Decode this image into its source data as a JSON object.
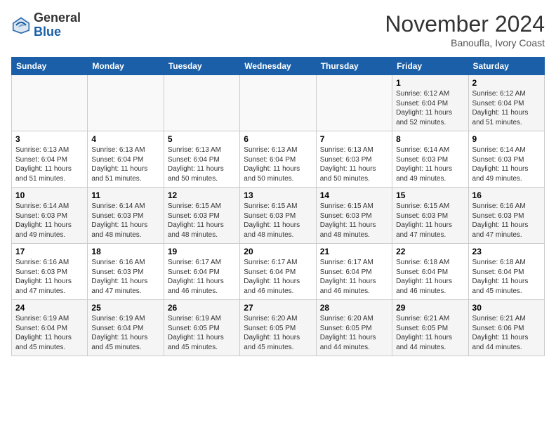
{
  "app": {
    "logo_general": "General",
    "logo_blue": "Blue"
  },
  "header": {
    "title": "November 2024",
    "subtitle": "Banoufla, Ivory Coast"
  },
  "calendar": {
    "days_of_week": [
      "Sunday",
      "Monday",
      "Tuesday",
      "Wednesday",
      "Thursday",
      "Friday",
      "Saturday"
    ],
    "weeks": [
      [
        {
          "day": "",
          "info": ""
        },
        {
          "day": "",
          "info": ""
        },
        {
          "day": "",
          "info": ""
        },
        {
          "day": "",
          "info": ""
        },
        {
          "day": "",
          "info": ""
        },
        {
          "day": "1",
          "info": "Sunrise: 6:12 AM\nSunset: 6:04 PM\nDaylight: 11 hours\nand 52 minutes."
        },
        {
          "day": "2",
          "info": "Sunrise: 6:12 AM\nSunset: 6:04 PM\nDaylight: 11 hours\nand 51 minutes."
        }
      ],
      [
        {
          "day": "3",
          "info": "Sunrise: 6:13 AM\nSunset: 6:04 PM\nDaylight: 11 hours\nand 51 minutes."
        },
        {
          "day": "4",
          "info": "Sunrise: 6:13 AM\nSunset: 6:04 PM\nDaylight: 11 hours\nand 51 minutes."
        },
        {
          "day": "5",
          "info": "Sunrise: 6:13 AM\nSunset: 6:04 PM\nDaylight: 11 hours\nand 50 minutes."
        },
        {
          "day": "6",
          "info": "Sunrise: 6:13 AM\nSunset: 6:04 PM\nDaylight: 11 hours\nand 50 minutes."
        },
        {
          "day": "7",
          "info": "Sunrise: 6:13 AM\nSunset: 6:03 PM\nDaylight: 11 hours\nand 50 minutes."
        },
        {
          "day": "8",
          "info": "Sunrise: 6:14 AM\nSunset: 6:03 PM\nDaylight: 11 hours\nand 49 minutes."
        },
        {
          "day": "9",
          "info": "Sunrise: 6:14 AM\nSunset: 6:03 PM\nDaylight: 11 hours\nand 49 minutes."
        }
      ],
      [
        {
          "day": "10",
          "info": "Sunrise: 6:14 AM\nSunset: 6:03 PM\nDaylight: 11 hours\nand 49 minutes."
        },
        {
          "day": "11",
          "info": "Sunrise: 6:14 AM\nSunset: 6:03 PM\nDaylight: 11 hours\nand 48 minutes."
        },
        {
          "day": "12",
          "info": "Sunrise: 6:15 AM\nSunset: 6:03 PM\nDaylight: 11 hours\nand 48 minutes."
        },
        {
          "day": "13",
          "info": "Sunrise: 6:15 AM\nSunset: 6:03 PM\nDaylight: 11 hours\nand 48 minutes."
        },
        {
          "day": "14",
          "info": "Sunrise: 6:15 AM\nSunset: 6:03 PM\nDaylight: 11 hours\nand 48 minutes."
        },
        {
          "day": "15",
          "info": "Sunrise: 6:15 AM\nSunset: 6:03 PM\nDaylight: 11 hours\nand 47 minutes."
        },
        {
          "day": "16",
          "info": "Sunrise: 6:16 AM\nSunset: 6:03 PM\nDaylight: 11 hours\nand 47 minutes."
        }
      ],
      [
        {
          "day": "17",
          "info": "Sunrise: 6:16 AM\nSunset: 6:03 PM\nDaylight: 11 hours\nand 47 minutes."
        },
        {
          "day": "18",
          "info": "Sunrise: 6:16 AM\nSunset: 6:03 PM\nDaylight: 11 hours\nand 47 minutes."
        },
        {
          "day": "19",
          "info": "Sunrise: 6:17 AM\nSunset: 6:04 PM\nDaylight: 11 hours\nand 46 minutes."
        },
        {
          "day": "20",
          "info": "Sunrise: 6:17 AM\nSunset: 6:04 PM\nDaylight: 11 hours\nand 46 minutes."
        },
        {
          "day": "21",
          "info": "Sunrise: 6:17 AM\nSunset: 6:04 PM\nDaylight: 11 hours\nand 46 minutes."
        },
        {
          "day": "22",
          "info": "Sunrise: 6:18 AM\nSunset: 6:04 PM\nDaylight: 11 hours\nand 46 minutes."
        },
        {
          "day": "23",
          "info": "Sunrise: 6:18 AM\nSunset: 6:04 PM\nDaylight: 11 hours\nand 45 minutes."
        }
      ],
      [
        {
          "day": "24",
          "info": "Sunrise: 6:19 AM\nSunset: 6:04 PM\nDaylight: 11 hours\nand 45 minutes."
        },
        {
          "day": "25",
          "info": "Sunrise: 6:19 AM\nSunset: 6:04 PM\nDaylight: 11 hours\nand 45 minutes."
        },
        {
          "day": "26",
          "info": "Sunrise: 6:19 AM\nSunset: 6:05 PM\nDaylight: 11 hours\nand 45 minutes."
        },
        {
          "day": "27",
          "info": "Sunrise: 6:20 AM\nSunset: 6:05 PM\nDaylight: 11 hours\nand 45 minutes."
        },
        {
          "day": "28",
          "info": "Sunrise: 6:20 AM\nSunset: 6:05 PM\nDaylight: 11 hours\nand 44 minutes."
        },
        {
          "day": "29",
          "info": "Sunrise: 6:21 AM\nSunset: 6:05 PM\nDaylight: 11 hours\nand 44 minutes."
        },
        {
          "day": "30",
          "info": "Sunrise: 6:21 AM\nSunset: 6:06 PM\nDaylight: 11 hours\nand 44 minutes."
        }
      ]
    ]
  }
}
